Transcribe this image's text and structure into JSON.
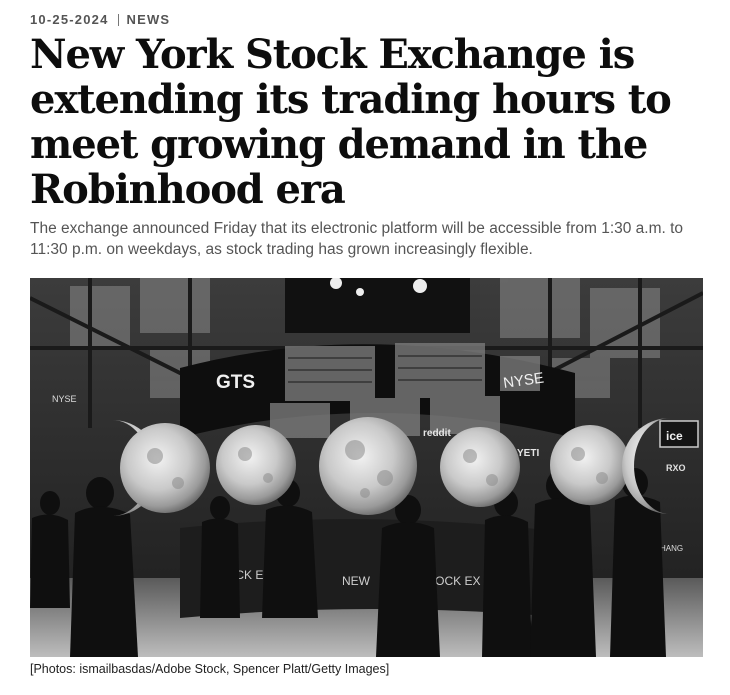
{
  "article": {
    "date": "10-25-2024",
    "section": "NEWS",
    "headline": "New York Stock Exchange is extending its trading hours to meet growing demand in the Robinhood era",
    "dek": "The exchange announced Friday that its electronic platform will be accessible from 1:30 a.m. to 11:30 p.m. on weekdays, as stock trading has grown increasingly flexible.",
    "photo_credit": "[Photos: ismailbasdas/Adobe Stock, Spencer Platt/Getty Images]"
  },
  "photo": {
    "signs": {
      "gts": "GTS",
      "nyse": "NYSE",
      "nyse_small": "NYSE",
      "reddit": "reddit",
      "yeti": "YETI",
      "ice": "ice",
      "rxo": "RXO",
      "stock_exchange_left": "OCK EXC",
      "stock_exchange_mid": "NEW",
      "stock_exchange_right": "TOCK EX",
      "hang": "HANG"
    }
  }
}
